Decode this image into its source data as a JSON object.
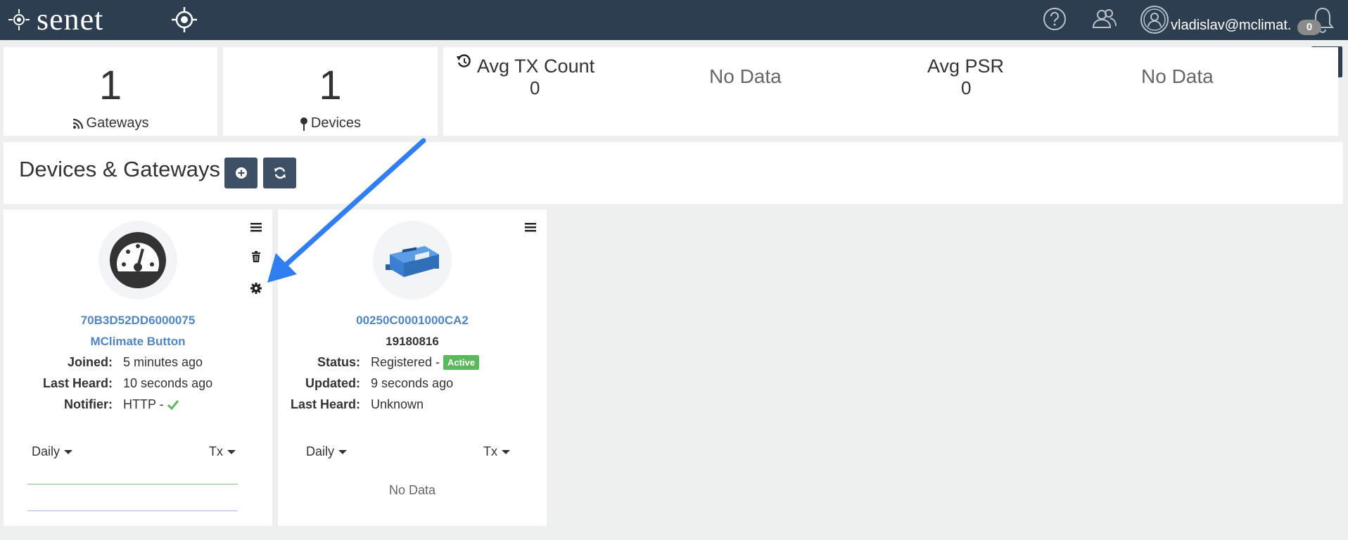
{
  "nav": {
    "brand": "senet",
    "user": "vladislav@mclimat...",
    "notifications": "0",
    "icons": [
      "brand-logo-icon",
      "target-icon",
      "help-icon",
      "users-icon",
      "user-avatar-icon",
      "bell-icon",
      "gear-icon"
    ]
  },
  "stats": {
    "gateways": {
      "count": "1",
      "label": "Gateways"
    },
    "devices": {
      "count": "1",
      "label": "Devices"
    },
    "avg_tx": {
      "label": "Avg TX Count",
      "value": "0",
      "chart": "No Data"
    },
    "avg_psr": {
      "label": "Avg PSR",
      "value": "0",
      "chart": "No Data"
    }
  },
  "section": {
    "title": "Devices & Gateways"
  },
  "devices": [
    {
      "id": "70B3D52DD6000075",
      "name": "MClimate Button",
      "fields": [
        {
          "label": "Joined:",
          "value": "5 minutes ago"
        },
        {
          "label": "Last Heard:",
          "value": "10 seconds ago"
        },
        {
          "label": "Notifier:",
          "value": "HTTP -"
        }
      ],
      "period": "Daily",
      "metric": "Tx"
    },
    {
      "id": "00250C0001000CA2",
      "name": "19180816",
      "fields": [
        {
          "label": "Status:",
          "value": "Registered -",
          "badge": "Active"
        },
        {
          "label": "Updated:",
          "value": "9 seconds ago"
        },
        {
          "label": "Last Heard:",
          "value": "Unknown"
        }
      ],
      "period": "Daily",
      "metric": "Tx",
      "chart": "No Data"
    }
  ],
  "colors": {
    "navbar": "#2d3e50",
    "link": "#4f86c6",
    "active": "#5cb85c",
    "annotation_arrow": "#2f7ef2"
  }
}
